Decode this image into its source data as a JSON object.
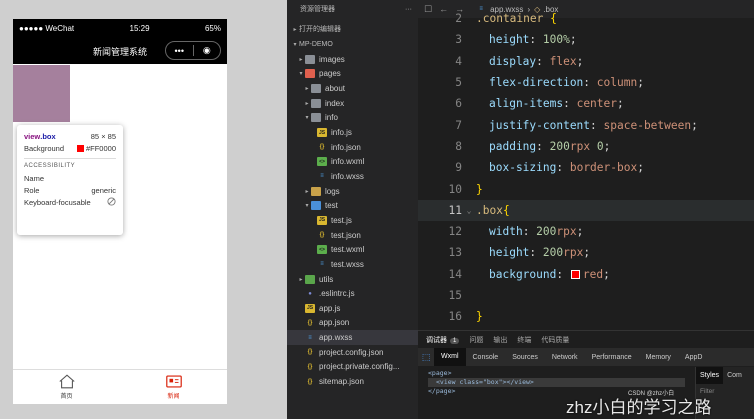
{
  "simulator": {
    "status": {
      "signal": "●●●●● WeChat",
      "time": "15:29",
      "battery": "65%"
    },
    "nav_title": "新闻管理系统",
    "capsule": {
      "more": "•••",
      "close": "◉"
    },
    "box_color": "#a5809d",
    "tooltip": {
      "selector_tag": "view",
      "selector_class": ".box",
      "size": "85 × 85",
      "background_label": "Background",
      "background_value": "#FF0000",
      "accessibility_title": "ACCESSIBILITY",
      "name_label": "Name",
      "name_value": "",
      "role_label": "Role",
      "role_value": "generic",
      "keyboard_label": "Keyboard-focusable"
    },
    "tabbar": [
      {
        "label": "首页",
        "icon": "home-icon",
        "active": false
      },
      {
        "label": "新闻",
        "icon": "news-icon",
        "active": true
      }
    ]
  },
  "explorer": {
    "title": "资源管理器",
    "more": "···",
    "open_editors": "打开的编辑器",
    "project": "MP-DEMO",
    "tree": [
      {
        "label": "images",
        "type": "folder-gray",
        "depth": 1,
        "twisty": "▸"
      },
      {
        "label": "pages",
        "type": "folder-red",
        "depth": 1,
        "twisty": "▾"
      },
      {
        "label": "about",
        "type": "folder-gray",
        "depth": 2,
        "twisty": "▸"
      },
      {
        "label": "index",
        "type": "folder-gray",
        "depth": 2,
        "twisty": "▸"
      },
      {
        "label": "info",
        "type": "folder-gray",
        "depth": 2,
        "twisty": "▾"
      },
      {
        "label": "info.js",
        "type": "js",
        "depth": 3,
        "twisty": ""
      },
      {
        "label": "info.json",
        "type": "json",
        "depth": 3,
        "twisty": ""
      },
      {
        "label": "info.wxml",
        "type": "wxml",
        "depth": 3,
        "twisty": ""
      },
      {
        "label": "info.wxss",
        "type": "wxss",
        "depth": 3,
        "twisty": ""
      },
      {
        "label": "logs",
        "type": "folder",
        "depth": 2,
        "twisty": "▸"
      },
      {
        "label": "test",
        "type": "folder-blue",
        "depth": 2,
        "twisty": "▾"
      },
      {
        "label": "test.js",
        "type": "js",
        "depth": 3,
        "twisty": ""
      },
      {
        "label": "test.json",
        "type": "json",
        "depth": 3,
        "twisty": ""
      },
      {
        "label": "test.wxml",
        "type": "wxml",
        "depth": 3,
        "twisty": ""
      },
      {
        "label": "test.wxss",
        "type": "wxss",
        "depth": 3,
        "twisty": ""
      },
      {
        "label": "utils",
        "type": "folder-green",
        "depth": 1,
        "twisty": "▸"
      },
      {
        "label": ".eslintrc.js",
        "type": "dot",
        "depth": 1,
        "twisty": ""
      },
      {
        "label": "app.js",
        "type": "js",
        "depth": 1,
        "twisty": ""
      },
      {
        "label": "app.json",
        "type": "json",
        "depth": 1,
        "twisty": ""
      },
      {
        "label": "app.wxss",
        "type": "wxss",
        "depth": 1,
        "twisty": "",
        "selected": true
      },
      {
        "label": "project.config.json",
        "type": "json",
        "depth": 1,
        "twisty": ""
      },
      {
        "label": "project.private.config...",
        "type": "json",
        "depth": 1,
        "twisty": ""
      },
      {
        "label": "sitemap.json",
        "type": "json",
        "depth": 1,
        "twisty": ""
      }
    ]
  },
  "editor": {
    "file": "app.wxss",
    "breadcrumb_sep": "›",
    "selector": ".box",
    "lines": [
      {
        "n": "2",
        "tokens": [
          [
            "s",
            ".container "
          ],
          [
            "br",
            "{"
          ]
        ],
        "indent": 0
      },
      {
        "n": "3",
        "tokens": [
          [
            "p",
            "height"
          ],
          [
            "t",
            ": "
          ],
          [
            "n",
            "100%"
          ],
          [
            "t",
            ";"
          ]
        ],
        "indent": 1
      },
      {
        "n": "4",
        "tokens": [
          [
            "p",
            "display"
          ],
          [
            "t",
            ": "
          ],
          [
            "v",
            "flex"
          ],
          [
            "t",
            ";"
          ]
        ],
        "indent": 1
      },
      {
        "n": "5",
        "tokens": [
          [
            "p",
            "flex-direction"
          ],
          [
            "t",
            ": "
          ],
          [
            "v",
            "column"
          ],
          [
            "t",
            ";"
          ]
        ],
        "indent": 1
      },
      {
        "n": "6",
        "tokens": [
          [
            "p",
            "align-items"
          ],
          [
            "t",
            ": "
          ],
          [
            "v",
            "center"
          ],
          [
            "t",
            ";"
          ]
        ],
        "indent": 1
      },
      {
        "n": "7",
        "tokens": [
          [
            "p",
            "justify-content"
          ],
          [
            "t",
            ": "
          ],
          [
            "v",
            "space-between"
          ],
          [
            "t",
            ";"
          ]
        ],
        "indent": 1
      },
      {
        "n": "8",
        "tokens": [
          [
            "p",
            "padding"
          ],
          [
            "t",
            ": "
          ],
          [
            "n",
            "200"
          ],
          [
            "v",
            "rpx "
          ],
          [
            "n",
            "0"
          ],
          [
            "t",
            ";"
          ]
        ],
        "indent": 1
      },
      {
        "n": "9",
        "tokens": [
          [
            "p",
            "box-sizing"
          ],
          [
            "t",
            ": "
          ],
          [
            "v",
            "border-box"
          ],
          [
            "t",
            ";"
          ]
        ],
        "indent": 1
      },
      {
        "n": "10",
        "tokens": [
          [
            "br",
            "}"
          ]
        ],
        "indent": 0
      },
      {
        "n": "11",
        "tokens": [
          [
            "s",
            ".box"
          ],
          [
            "br",
            "{"
          ]
        ],
        "indent": 0,
        "current": true,
        "fold": "⌄"
      },
      {
        "n": "12",
        "tokens": [
          [
            "p",
            "width"
          ],
          [
            "t",
            ": "
          ],
          [
            "n",
            "200"
          ],
          [
            "v",
            "rpx"
          ],
          [
            "t",
            ";"
          ]
        ],
        "indent": 1
      },
      {
        "n": "13",
        "tokens": [
          [
            "p",
            "height"
          ],
          [
            "t",
            ": "
          ],
          [
            "n",
            "200"
          ],
          [
            "v",
            "rpx"
          ],
          [
            "t",
            ";"
          ]
        ],
        "indent": 1
      },
      {
        "n": "14",
        "tokens": [
          [
            "p",
            "background"
          ],
          [
            "t",
            ": "
          ],
          [
            "sw",
            ""
          ],
          [
            "v",
            "red"
          ],
          [
            "t",
            ";"
          ]
        ],
        "indent": 1
      },
      {
        "n": "15",
        "tokens": [],
        "indent": 0
      },
      {
        "n": "16",
        "tokens": [
          [
            "br",
            "}"
          ]
        ],
        "indent": 0
      }
    ]
  },
  "panel": {
    "tabs": [
      {
        "label": "调试器",
        "badge": "1",
        "active": true
      },
      {
        "label": "问题"
      },
      {
        "label": "输出"
      },
      {
        "label": "终端"
      },
      {
        "label": "代码质量"
      }
    ],
    "devtools_tabs": [
      "Wxml",
      "Console",
      "Sources",
      "Network",
      "Performance",
      "Memory",
      "AppD"
    ],
    "wxml_lines": [
      {
        "text": "<page>",
        "highlight": false
      },
      {
        "text": "<view class=\"box\"></view>",
        "highlight": true
      },
      {
        "text": "</page>",
        "highlight": false
      }
    ],
    "styles_tab": "Styles",
    "computed_tab": "Com",
    "filter_placeholder": "Filter"
  },
  "watermark": "zhz小白的学习之路",
  "csdn_mark": "CSDN @zhz小白"
}
